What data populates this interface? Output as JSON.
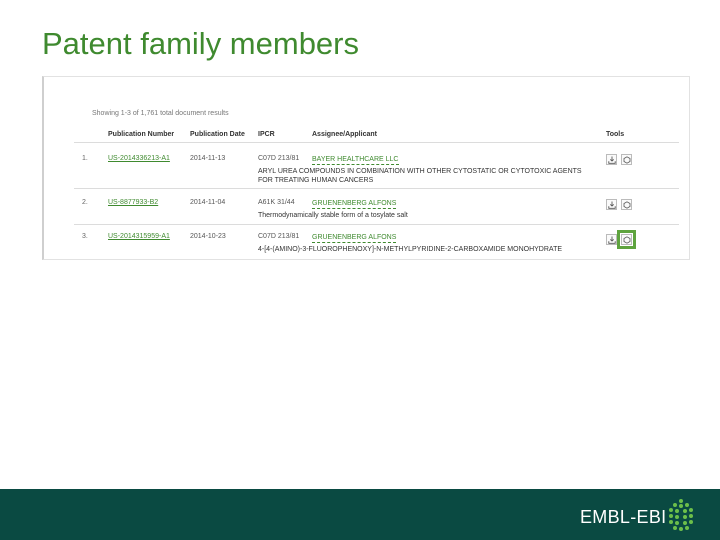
{
  "slide": {
    "title": "Patent family members",
    "brand": "EMBL-EBI"
  },
  "results": {
    "showing_text": "Showing 1-3 of 1,761 total document results",
    "columns": [
      "Publication Number",
      "Publication Date",
      "IPCR",
      "Assignee/Applicant",
      "Tools"
    ],
    "rows": [
      {
        "index": "1.",
        "publication_number": "US-2014336213-A1",
        "publication_date": "2014-11-13",
        "ipcr": "C07D 213/81",
        "assignee": "BAYER HEALTHCARE LLC",
        "title": "ARYL UREA COMPOUNDS IN COMBINATION WITH OTHER CYTOSTATIC OR CYTOTOXIC AGENTS FOR TREATING HUMAN CANCERS"
      },
      {
        "index": "2.",
        "publication_number": "US-8877933-B2",
        "publication_date": "2014-11-04",
        "ipcr": "A61K 31/44",
        "assignee": "GRUENENBERG ALFONS",
        "title": "Thermodynamically stable form of a tosylate salt"
      },
      {
        "index": "3.",
        "publication_number": "US-2014315959-A1",
        "publication_date": "2014-10-23",
        "ipcr": "C07D 213/81",
        "assignee": "GRUENENBERG ALFONS",
        "title": "4-[4-(AMINO)-3-FLUOROPHENOXY]-N-METHYLPYRIDINE-2-CARBOXAMIDE MONOHYDRATE"
      }
    ]
  },
  "icons": {
    "download": "download-icon",
    "structure": "chemical-structure-icon",
    "brand_mark": "embl-ebi-logo-icon"
  },
  "colors": {
    "title_green": "#3f8a2f",
    "link_green": "#3f8a2f",
    "highlight_green": "#5ea33e",
    "footer_teal": "#0a4a42"
  }
}
